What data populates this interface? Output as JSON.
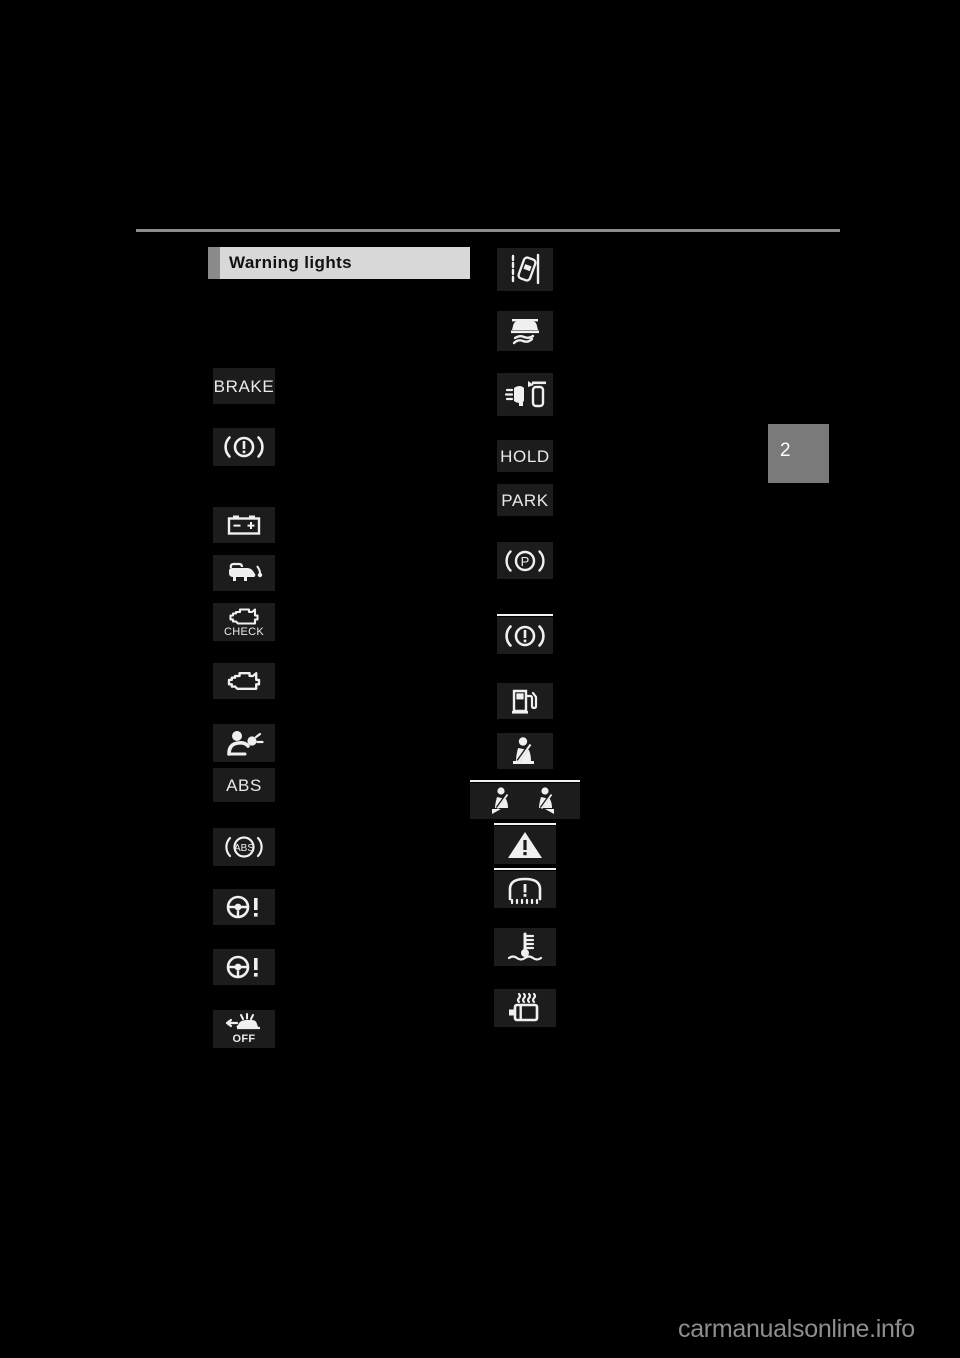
{
  "page": {
    "background_color": "#000000",
    "chapter_tab": {
      "number": "2",
      "color": "#7a7a7a"
    },
    "watermark": "carmanualsonline.info",
    "rule_color": "#8c8c8c"
  },
  "section": {
    "title": "Warning lights",
    "accent_color": "#8a8a8a",
    "bar_color": "#d8d8d8",
    "text_color": "#111111"
  },
  "columns": {
    "left": {
      "name": "left-icon-column",
      "icons": [
        {
          "id": "brake-system-text",
          "name": "brake-warning-text-icon",
          "label": "BRAKE",
          "type": "text"
        },
        {
          "id": "brake-system-symbol",
          "name": "brake-system-warning-icon",
          "label": "",
          "type": "glyph"
        },
        {
          "id": "charging-system",
          "name": "battery-charging-warning-icon",
          "label": "",
          "type": "glyph"
        },
        {
          "id": "low-oil-pressure",
          "name": "oil-pressure-warning-icon",
          "label": "",
          "type": "glyph"
        },
        {
          "id": "check-engine",
          "name": "check-engine-warning-icon",
          "label": "CHECK",
          "type": "glyph-text"
        },
        {
          "id": "malfunction-indicator",
          "name": "engine-malfunction-warning-icon",
          "label": "",
          "type": "glyph"
        },
        {
          "id": "srs-airbag",
          "name": "srs-airbag-warning-icon",
          "label": "",
          "type": "glyph"
        },
        {
          "id": "abs-text",
          "name": "abs-warning-text-icon",
          "label": "ABS",
          "type": "text"
        },
        {
          "id": "abs-symbol",
          "name": "abs-warning-icon",
          "label": "ABS",
          "type": "glyph-text"
        },
        {
          "id": "eps-warning-1",
          "name": "electric-power-steering-warning-icon",
          "label": "",
          "type": "glyph"
        },
        {
          "id": "eps-warning-2",
          "name": "power-steering-warning-icon",
          "label": "",
          "type": "glyph"
        },
        {
          "id": "pcs-off",
          "name": "pre-collision-system-off-icon",
          "label": "OFF",
          "type": "glyph-text"
        }
      ]
    },
    "right": {
      "name": "right-icon-column",
      "icons": [
        {
          "id": "lane-departure-alert",
          "name": "lane-departure-alert-warning-icon",
          "label": "",
          "type": "glyph"
        },
        {
          "id": "slip-indicator",
          "name": "vsc-slip-indicator-icon",
          "label": "",
          "type": "glyph"
        },
        {
          "id": "afs-warning",
          "name": "adaptive-front-lighting-warning-icon",
          "label": "",
          "type": "glyph"
        },
        {
          "id": "hold-indicator",
          "name": "brake-hold-text-icon",
          "label": "HOLD",
          "type": "text"
        },
        {
          "id": "park-indicator",
          "name": "electric-parking-brake-text-icon",
          "label": "PARK",
          "type": "text"
        },
        {
          "id": "parking-brake-symbol",
          "name": "parking-brake-warning-icon",
          "label": "P",
          "type": "glyph"
        },
        {
          "id": "brake-warning-symbol",
          "name": "brake-system-warning-icon-2",
          "label": "",
          "type": "glyph"
        },
        {
          "id": "low-fuel",
          "name": "low-fuel-warning-icon",
          "label": "",
          "type": "glyph"
        },
        {
          "id": "seat-belt-front",
          "name": "front-seat-belt-reminder-icon",
          "label": "",
          "type": "glyph"
        },
        {
          "id": "seat-belt-rear",
          "name": "rear-seat-belt-reminder-icon",
          "label": "",
          "type": "glyph"
        },
        {
          "id": "master-warning",
          "name": "master-warning-triangle-icon",
          "label": "",
          "type": "glyph"
        },
        {
          "id": "tire-pressure",
          "name": "tire-pressure-warning-icon",
          "label": "",
          "type": "glyph"
        },
        {
          "id": "engine-coolant-temp",
          "name": "engine-coolant-temperature-icon",
          "label": "",
          "type": "glyph"
        },
        {
          "id": "transmission-overheat",
          "name": "transmission-overheat-warning-icon",
          "label": "",
          "type": "glyph"
        }
      ]
    }
  }
}
